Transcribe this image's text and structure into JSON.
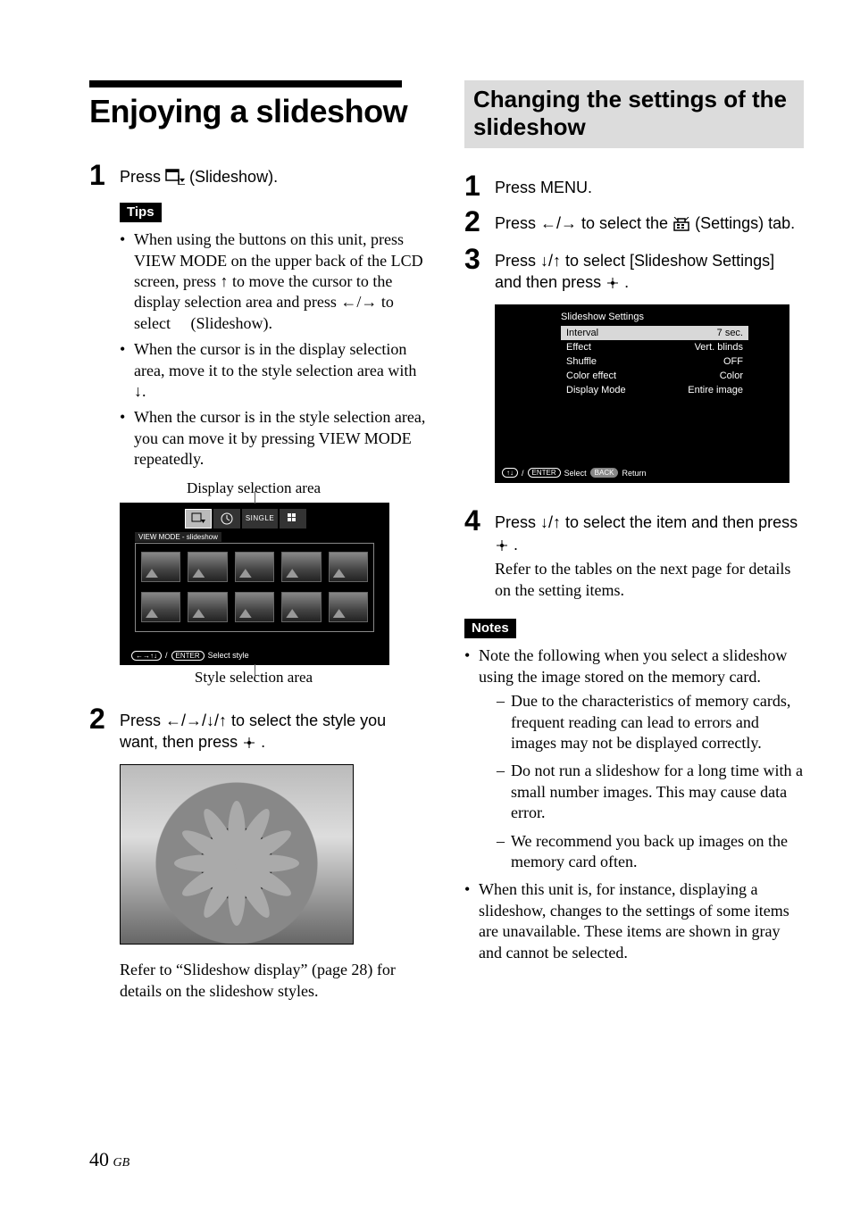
{
  "left": {
    "title": "Enjoying a slideshow",
    "step1": {
      "text_a": "Press ",
      "text_b": " (Slideshow)."
    },
    "tips_label": "Tips",
    "tips": [
      "When using the buttons on this unit, press VIEW MODE on the upper back of the LCD screen, press ↑ to move the cursor to the display selection area and press ←/→ to select     (Slideshow).",
      "When the cursor is in the display selection area, move it to the style selection area with ↓.",
      "When the cursor is in the style selection area, you can move it by pressing VIEW MODE repeatedly."
    ],
    "cap_display": "Display selection area",
    "mock": {
      "tab_single": "SINGLE",
      "label": "VIEW MODE - slideshow",
      "hint_nav": "←→↑↓",
      "hint_enter": "ENTER",
      "hint_text": "Select style"
    },
    "cap_style": "Style selection area",
    "step2": {
      "line1a": "Press ←/→/↓/↑ to select the style you",
      "line1b": "want, then press ",
      "line1c": "."
    },
    "ref": "Refer to “Slideshow display” (page 28) for details on the slideshow styles."
  },
  "right": {
    "heading": "Changing the settings of the slideshow",
    "step1": "Press MENU.",
    "step2a": "Press ←/→ to select the ",
    "step2b": " (Settings) tab.",
    "step3a": "Press ↓/↑ to select [Slideshow Settings] and then press ",
    "step3b": ".",
    "settings": {
      "title": "Slideshow Settings",
      "rows": [
        {
          "k": "Interval",
          "v": "7 sec."
        },
        {
          "k": "Effect",
          "v": "Vert. blinds"
        },
        {
          "k": "Shuffle",
          "v": "OFF"
        },
        {
          "k": "Color effect",
          "v": "Color"
        },
        {
          "k": "Display Mode",
          "v": "Entire image"
        }
      ],
      "hint_nav": "↑↓",
      "hint_enter": "ENTER",
      "hint_sel": "Select",
      "hint_back": "BACK",
      "hint_ret": "Return"
    },
    "step4a": "Press ↓/↑ to select the item and then press ",
    "step4b": ".",
    "step4_serif": "Refer to the tables on the next page for details on the setting items.",
    "notes_label": "Notes",
    "note_intro": "Note the following when you select a slideshow using the image stored on the memory card.",
    "note_subs": [
      "Due to the characteristics of memory cards, frequent reading can lead to errors and images may not be displayed correctly.",
      "Do not run a slideshow for a long time with a small number images. This may cause data error.",
      "We recommend you back up images on the memory card often."
    ],
    "note2": "When this unit is, for instance, displaying a slideshow, changes to the settings of some items are unavailable. These items are shown in gray and cannot be selected."
  },
  "footer": {
    "page": "40",
    "region": "GB"
  }
}
